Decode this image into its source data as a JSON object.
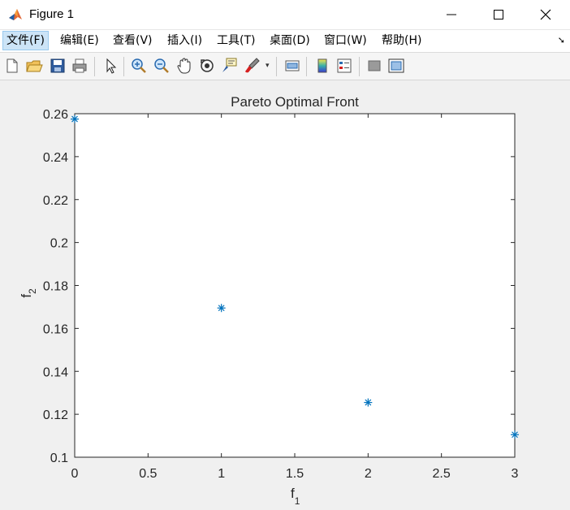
{
  "window": {
    "title": "Figure 1",
    "minimize_icon": "minimize-icon",
    "maximize_icon": "maximize-icon",
    "close_icon": "close-icon"
  },
  "menu": {
    "items": [
      "文件(F)",
      "编辑(E)",
      "查看(V)",
      "插入(I)",
      "工具(T)",
      "桌面(D)",
      "窗口(W)",
      "帮助(H)"
    ],
    "overflow_icon": "dock-arrow-icon"
  },
  "toolbar": {
    "buttons": [
      "new-figure-icon",
      "open-file-icon",
      "save-icon",
      "print-icon",
      "pointer-icon",
      "zoom-in-icon",
      "zoom-out-icon",
      "pan-hand-icon",
      "rotate-3d-icon",
      "data-cursor-icon",
      "brush-icon",
      "link-plot-icon",
      "colorbar-icon",
      "legend-icon",
      "hide-plot-tools-icon",
      "show-plot-tools-icon"
    ]
  },
  "chart_data": {
    "type": "scatter",
    "title": "Pareto Optimal Front",
    "xlabel": "f",
    "xlabel_sub": "1",
    "ylabel": "f",
    "ylabel_sub": "2",
    "xlim": [
      0,
      3
    ],
    "ylim": [
      0.1,
      0.26
    ],
    "x_ticks": [
      "0",
      "0.5",
      "1",
      "1.5",
      "2",
      "2.5",
      "3"
    ],
    "y_ticks": [
      "0.1",
      "0.12",
      "0.14",
      "0.16",
      "0.18",
      "0.2",
      "0.22",
      "0.24",
      "0.26"
    ],
    "marker": "*",
    "marker_color": "#0072bd",
    "points": [
      {
        "x": 0,
        "y": 0.2575
      },
      {
        "x": 1,
        "y": 0.1695
      },
      {
        "x": 2,
        "y": 0.1255
      },
      {
        "x": 3,
        "y": 0.1105
      }
    ]
  }
}
